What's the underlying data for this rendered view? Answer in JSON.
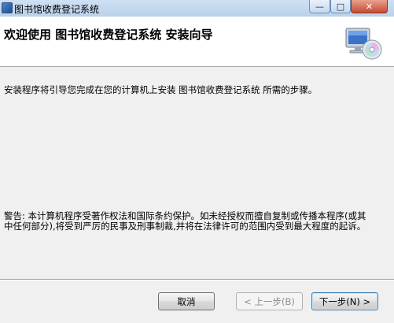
{
  "window": {
    "title": "图书馆收费登记系统",
    "minimize_symbol": "—",
    "maximize_symbol": "□",
    "close_symbol": "✕"
  },
  "header": {
    "title": "欢迎使用 图书馆收费登记系统 安装向导",
    "graphic_icon": "computer-cd-icon"
  },
  "content": {
    "intro": "安装程序将引导您完成在您的计算机上安装 图书馆收费登记系统 所需的步骤。",
    "warning": "警告: 本计算机程序受著作权法和国际条约保护。如未经授权而擅自复制或传播本程序(或其中任何部分),将受到严厉的民事及刑事制裁,并将在法律许可的范围内受到最大程度的起诉。"
  },
  "buttons": {
    "cancel": "取消",
    "back": "< 上一步(B)",
    "next": "下一步(N) >"
  }
}
